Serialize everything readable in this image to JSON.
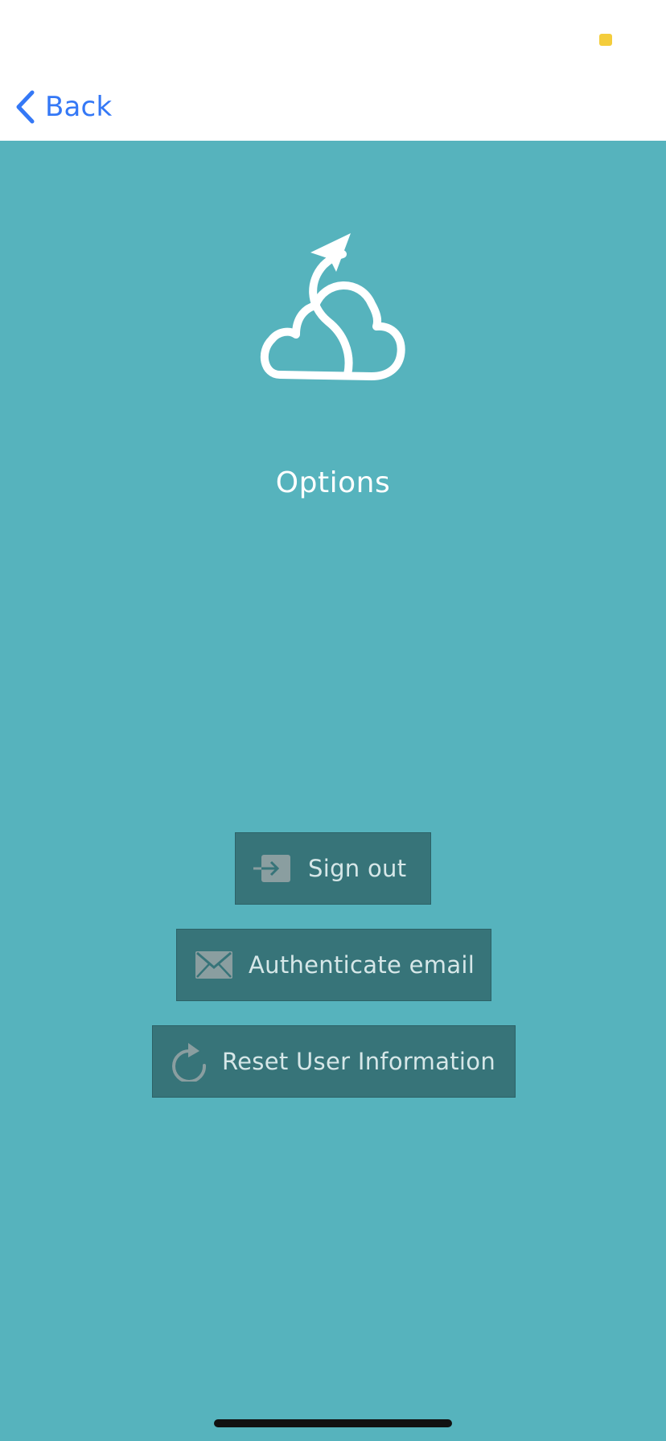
{
  "status_bar": {
    "battery_icon": "battery-icon",
    "battery_color": "#f4cd3c"
  },
  "nav": {
    "back_icon": "chevron-left-icon",
    "back_label": "Back",
    "accent_color": "#3478f6"
  },
  "header": {
    "logo_icon": "cloud-paper-plane-logo",
    "title": "Options"
  },
  "actions": {
    "sign_out": {
      "label": "Sign out",
      "icon": "sign-in-arrow-icon"
    },
    "authenticate_email": {
      "label": "Authenticate email",
      "icon": "envelope-icon"
    },
    "reset_user_info": {
      "label": "Reset User Information",
      "icon": "refresh-icon"
    }
  },
  "colors": {
    "background": "#56b3bd",
    "button_background": "#377479",
    "button_text": "#d6e7e8",
    "icon_color": "#8a9ea0"
  }
}
